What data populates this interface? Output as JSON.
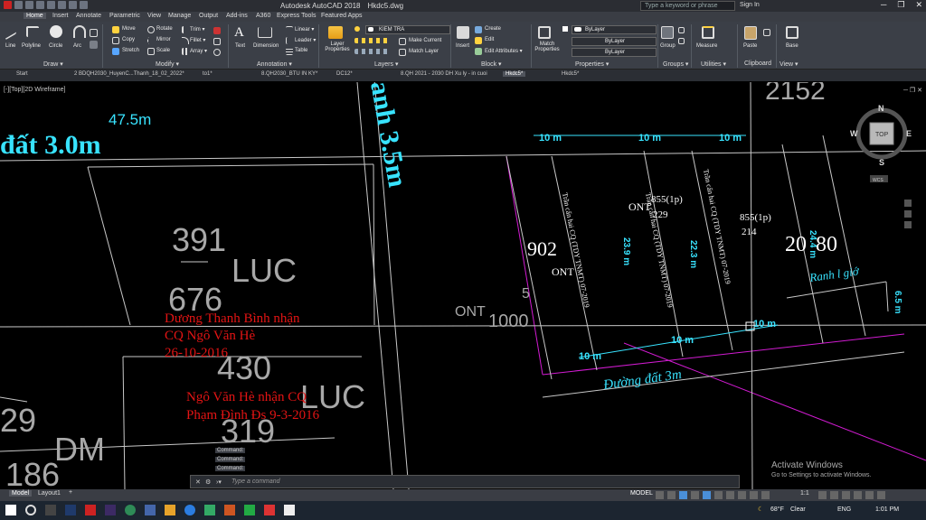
{
  "title_bar": {
    "app": "Autodesk AutoCAD 2018",
    "file": "Hkdc5.dwg",
    "search_placeholder": "Type a keyword or phrase",
    "sign_in": "Sign In"
  },
  "ribbon_tabs": [
    "Home",
    "Insert",
    "Annotate",
    "Parametric",
    "View",
    "Manage",
    "Output",
    "Add-ins",
    "A360",
    "Express Tools",
    "Featured Apps"
  ],
  "ribbon": {
    "draw": {
      "line": "Line",
      "polyline": "Polyline",
      "circle": "Circle",
      "arc": "Arc",
      "panel": "Draw ▾"
    },
    "modify": {
      "move": "Move",
      "rotate": "Rotate",
      "trim": "Trim ▾",
      "copy": "Copy",
      "mirror": "Mirror",
      "fillet": "Fillet ▾",
      "stretch": "Stretch",
      "scale": "Scale",
      "array": "Array ▾",
      "panel": "Modify ▾"
    },
    "annotation": {
      "text": "Text",
      "dimension": "Dimension",
      "linear": "Linear ▾",
      "leader": "Leader ▾",
      "table": "Table",
      "panel": "Annotation ▾"
    },
    "layers": {
      "layer_properties": "Layer Properties",
      "current_layer": "KIEM TRA",
      "make_current": "Make Current",
      "match_layer": "Match Layer",
      "panel": "Layers ▾"
    },
    "block": {
      "insert": "Insert",
      "create": "Create",
      "edit": "Edit",
      "edit_attributes": "Edit Attributes ▾",
      "panel": "Block ▾"
    },
    "properties": {
      "match": "Match Properties",
      "p1": "ByLayer",
      "p2": "ByLayer",
      "p3": "ByLayer",
      "panel": "Properties ▾"
    },
    "groups": {
      "group": "Group",
      "panel": "Groups ▾"
    },
    "utilities": {
      "measure": "Measure",
      "panel": "Utilities ▾"
    },
    "clipboard": {
      "paste": "Paste",
      "panel": "Clipboard"
    },
    "view": {
      "base": "Base",
      "panel": "View ▾"
    }
  },
  "file_tabs": [
    "Start",
    "2 BDQH2030_HuyenC...Thanh_18_02_2022*",
    "to1*",
    "8.QH2030_BTU IN KY*",
    "DC12*",
    "8.QH 2021 - 2030 DH Xu ly - in cuoi",
    "Hkdc5*",
    "Hkdc5*"
  ],
  "viewport_label": "[-][Top][2D Wireframe]",
  "viewcube": {
    "n": "N",
    "s": "S",
    "e": "E",
    "w": "W",
    "top": "TOP",
    "wcs": "WCS"
  },
  "drawing": {
    "road_left": "đất 3.0m",
    "road_vertical": "anh 3.5m",
    "dist_475": "47.5m",
    "parcel_391": "391",
    "luc1": "LUC",
    "num_676": "676",
    "parcel_430": "430",
    "luc2": "LUC",
    "num_319": "319",
    "num_29": "29",
    "dm": "DM",
    "num_186": "186",
    "top_2152": "2152",
    "handwrite": [
      "Dương Thanh Bình nhận",
      "CQ Ngô Văn Hè",
      "26-10-2016",
      "Ngô Văn Hè nhận CQ",
      "Phạm Đình Đs 9-3-2016"
    ],
    "dim_10": "10 m",
    "parcel_902": "902",
    "ont1": "ONT",
    "ont2": "ONT",
    "n855a": "855(1p)",
    "n229": "229",
    "n855b": "855(1p)",
    "n214": "214",
    "n20": "20",
    "n80": "80",
    "n1000": "1000",
    "n5": "5",
    "ont_bottom": "ONT",
    "d239": "23.9 m",
    "d223": "22.3 m",
    "d244": "24.4 m",
    "d65": "6.5 m",
    "ranh": "Ranh l giớ",
    "road_bottom": "Đường đất 3m",
    "ranh_n1": "Trần cấn hai CQ (TDY TNMT) 07-2019",
    "ranh_n2": "Trần cấn hai CQ (TDY TNMT) 07-2019",
    "ranh_n3": "Trần cấn hai CQ (TDY TNMT) 07-2019"
  },
  "command": {
    "history": [
      "Command:",
      "Command:",
      "Command:"
    ],
    "prompt": "Type a command"
  },
  "status_bar": {
    "model_tab": "Model",
    "layout_tab": "Layout1",
    "model": "MODEL",
    "scale": "1:1"
  },
  "activation": {
    "line1": "Activate Windows",
    "line2": "Go to Settings to activate Windows."
  },
  "taskbar": {
    "weather": "68°F",
    "condition": "Clear",
    "language": "ENG",
    "time": "1:01 PM"
  },
  "colors": {
    "cyan": "#38e3ff",
    "red": "#e31414",
    "magenta": "#d21bd2",
    "drawing_bg": "#000000"
  }
}
